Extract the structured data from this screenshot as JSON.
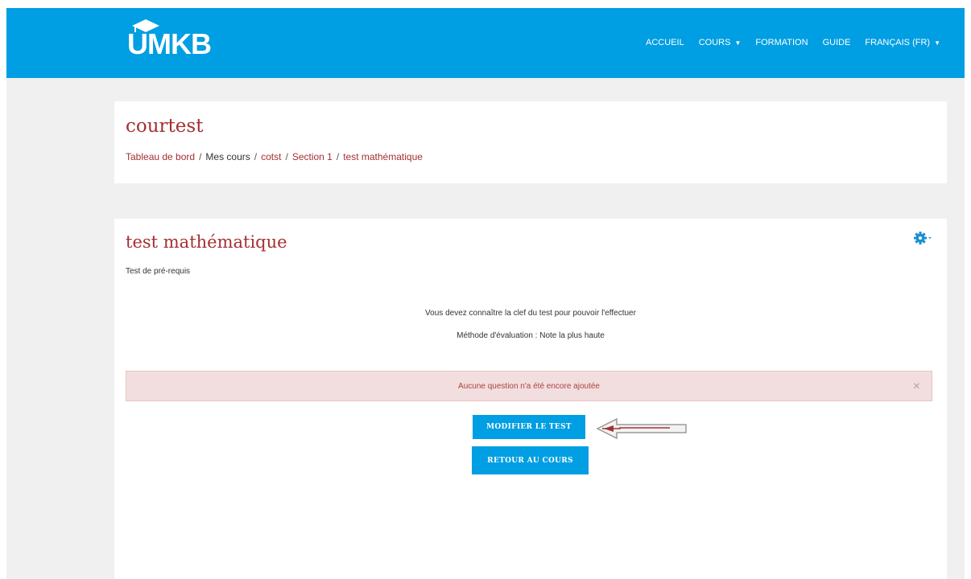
{
  "brand": {
    "logo_text": "UMKB"
  },
  "nav": {
    "items": [
      {
        "label": "ACCUEIL",
        "dropdown": false
      },
      {
        "label": "COURS",
        "dropdown": true
      },
      {
        "label": "FORMATION",
        "dropdown": false
      },
      {
        "label": "GUIDE",
        "dropdown": false
      },
      {
        "label": "FRANÇAIS (FR)",
        "dropdown": true
      }
    ]
  },
  "header": {
    "course_title": "courtest",
    "breadcrumb": [
      {
        "label": "Tableau de bord",
        "link": true
      },
      {
        "label": "Mes cours",
        "link": false
      },
      {
        "label": "cotst",
        "link": true
      },
      {
        "label": "Section 1",
        "link": true
      },
      {
        "label": "test mathématique",
        "link": true
      }
    ]
  },
  "quiz": {
    "title": "test mathématique",
    "intro": "Test de pré-requis",
    "info_key": "Vous devez connaître la clef du test pour pouvoir l'effectuer",
    "info_grading": "Méthode d'évaluation : Note la plus haute",
    "alert": "Aucune question n'a été encore ajoutée",
    "alert_close": "×",
    "edit_button": "MODIFIER LE TEST",
    "back_button": "RETOUR AU COURS"
  },
  "icons": {
    "gear": "gear-icon",
    "caret": "caret-down-icon",
    "arrow": "left-arrow-icon",
    "logo_cap": "graduation-cap-icon"
  },
  "colors": {
    "navbar": "#009ee2",
    "title": "#a52f32",
    "alert_bg": "#f2dede",
    "alert_text": "#a94442",
    "button": "#009ee2"
  }
}
